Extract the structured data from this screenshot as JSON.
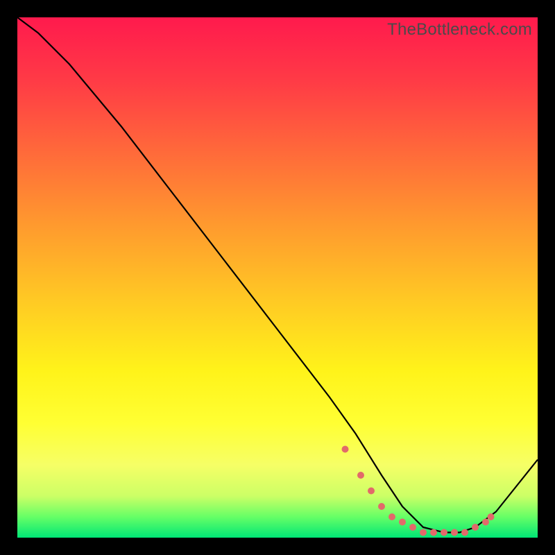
{
  "watermark": "TheBottleneck.com",
  "chart_data": {
    "type": "line",
    "title": "",
    "xlabel": "",
    "ylabel": "",
    "xlim": [
      0,
      100
    ],
    "ylim": [
      0,
      100
    ],
    "series": [
      {
        "name": "curve",
        "x": [
          0,
          4,
          10,
          20,
          30,
          40,
          50,
          60,
          65,
          70,
          74,
          78,
          82,
          85,
          88,
          92,
          100
        ],
        "y": [
          100,
          97,
          91,
          79,
          66,
          53,
          40,
          27,
          20,
          12,
          6,
          2,
          1,
          1,
          2,
          5,
          15
        ]
      }
    ],
    "markers": {
      "name": "dots",
      "color": "#e26a6a",
      "x": [
        63,
        66,
        68,
        70,
        72,
        74,
        76,
        78,
        80,
        82,
        84,
        86,
        88,
        90,
        91
      ],
      "y": [
        17,
        12,
        9,
        6,
        4,
        3,
        2,
        1,
        1,
        1,
        1,
        1,
        2,
        3,
        4
      ]
    }
  }
}
